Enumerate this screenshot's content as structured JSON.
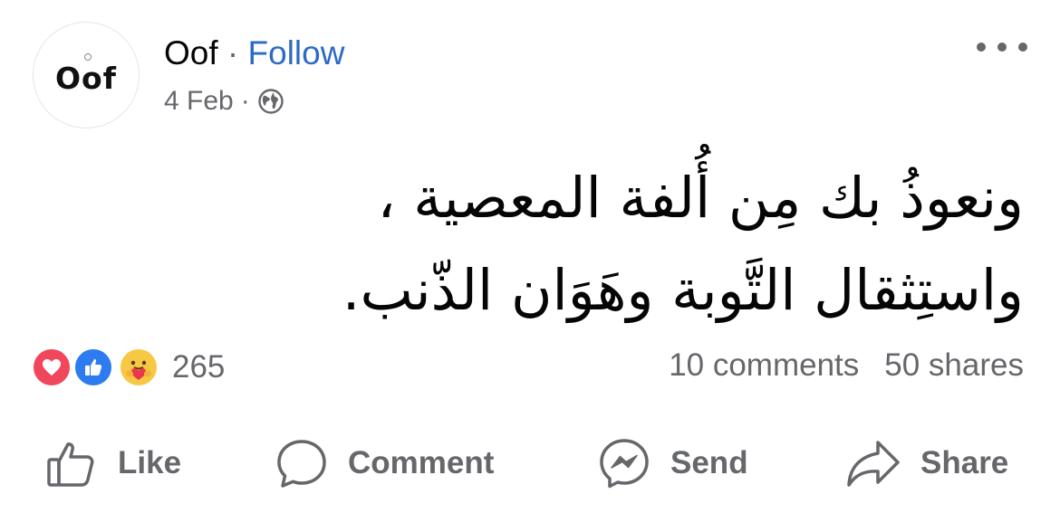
{
  "post": {
    "author": "Oof",
    "avatar_text": "Oof",
    "separator": "·",
    "follow_label": "Follow",
    "date": "4 Feb",
    "privacy_icon": "globe-icon",
    "body_lines": [
      "ونعوذُ بك مِن أُلفة المعصية ،",
      "واستِثقال التَّوبة وهَوَان الذّنب."
    ]
  },
  "stats": {
    "reaction_count": "265",
    "reaction_icons": [
      "love-reaction-icon",
      "like-reaction-icon",
      "care-reaction-icon"
    ],
    "comments": "10 comments",
    "shares": "50 shares"
  },
  "actions": {
    "like": "Like",
    "comment": "Comment",
    "send": "Send",
    "share": "Share"
  },
  "colors": {
    "follow": "#2d6ac6",
    "secondary_text": "#65676b",
    "love": "#f0475c",
    "like": "#2c7bf0",
    "care": "#f7c844"
  }
}
